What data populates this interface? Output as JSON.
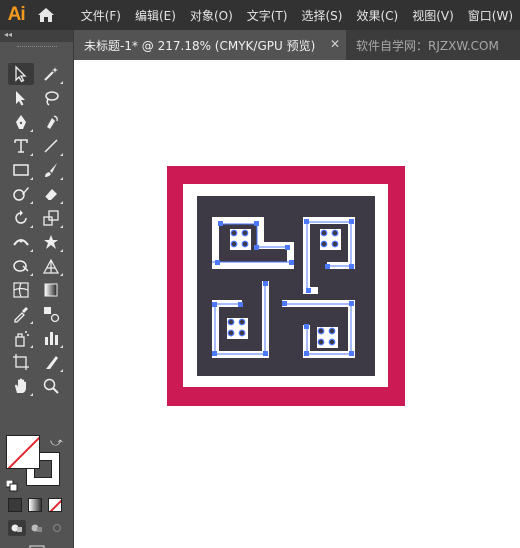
{
  "app": {
    "logo": "Ai"
  },
  "menu": [
    "文件(F)",
    "编辑(E)",
    "对象(O)",
    "文字(T)",
    "选择(S)",
    "效果(C)",
    "视图(V)",
    "窗口(W)"
  ],
  "tabs": {
    "active": "未标题-1* @ 217.18% (CMYK/GPU 预览)",
    "close": "✕",
    "inactive": "软件自学网：RJZXW.COM"
  },
  "toolbar": {
    "collapse": "◂◂",
    "swap": "⤻"
  },
  "colors": {
    "frame": "#cc1a55",
    "inner_bg": "#3d3a45",
    "white": "#ffffff",
    "selection": "#4d79ff",
    "accent": "#f39a1e"
  },
  "icons": [
    "home-icon",
    "selection-tool-icon",
    "magic-wand-icon",
    "direct-selection-icon",
    "lasso-icon",
    "pen-icon",
    "curvature-icon",
    "type-icon",
    "line-icon",
    "rectangle-icon",
    "paintbrush-icon",
    "shaper-icon",
    "eraser-icon",
    "rotate-icon",
    "scale-icon",
    "width-icon",
    "puppet-warp-icon",
    "shape-builder-icon",
    "perspective-grid-icon",
    "mesh-icon",
    "gradient-icon",
    "eyedropper-icon",
    "blend-icon",
    "symbol-sprayer-icon",
    "column-graph-icon",
    "artboard-icon",
    "slice-icon",
    "hand-icon",
    "zoom-icon"
  ]
}
